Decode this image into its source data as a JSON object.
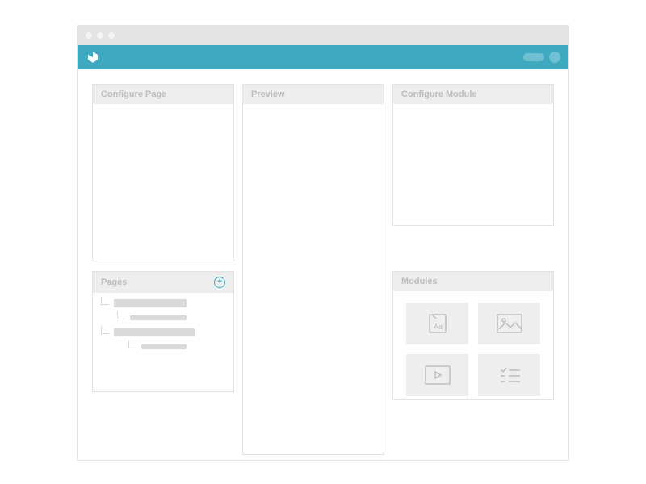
{
  "colors": {
    "accent": "#3fa9c1",
    "panel_header_bg": "#eeeeee",
    "border": "#e3e3e3",
    "muted_text": "#bdbdbd",
    "placeholder_bar": "#d9d9d9"
  },
  "header": {
    "logo_name": "app-logo",
    "controls": {
      "pill": "status-pill",
      "avatar": "user-avatar"
    }
  },
  "panels": {
    "configure_page": {
      "title": "Configure Page"
    },
    "preview": {
      "title": "Preview"
    },
    "configure_module": {
      "title": "Configure Module"
    },
    "pages": {
      "title": "Pages",
      "add_icon": "plus-icon",
      "items": [
        {
          "indent": 0
        },
        {
          "indent": 1
        },
        {
          "indent": 1
        },
        {
          "indent": 2
        }
      ]
    },
    "modules": {
      "title": "Modules",
      "tiles": [
        {
          "name": "text-module",
          "icon": "text-icon"
        },
        {
          "name": "image-module",
          "icon": "image-icon"
        },
        {
          "name": "video-module",
          "icon": "video-icon"
        },
        {
          "name": "list-module",
          "icon": "checklist-icon"
        }
      ]
    }
  }
}
